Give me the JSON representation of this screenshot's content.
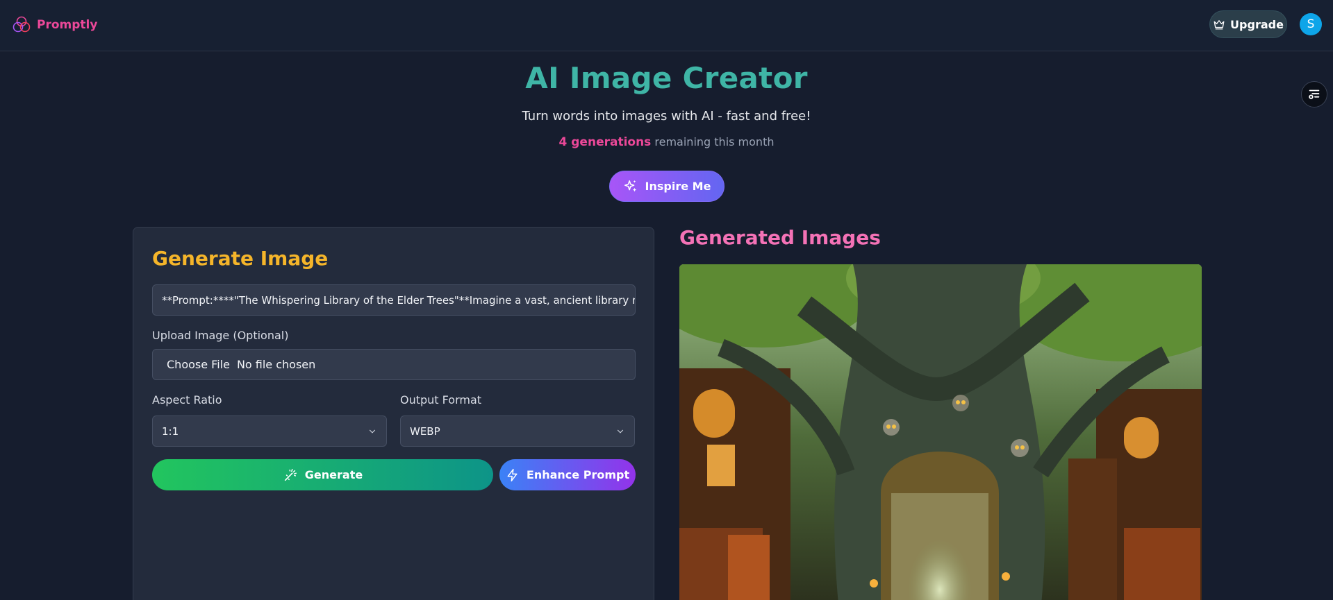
{
  "header": {
    "brand": "Promptly",
    "upgrade_label": "Upgrade",
    "avatar_initial": "S"
  },
  "hero": {
    "title": "AI Image Creator",
    "subtitle": "Turn words into images with AI - fast and free!",
    "generations_count": "4 generations",
    "generations_suffix": " remaining this month",
    "inspire_label": "Inspire Me"
  },
  "form": {
    "title": "Generate Image",
    "prompt_value": "**Prompt:****\"The Whispering Library of the Elder Trees\"**Imagine a vast, ancient library ne",
    "upload_label": "Upload Image (Optional)",
    "file_button": "Choose File",
    "file_status": "No file chosen",
    "aspect_label": "Aspect Ratio",
    "aspect_value": "1:1",
    "format_label": "Output Format",
    "format_value": "WEBP",
    "generate_label": "Generate",
    "enhance_label": "Enhance Prompt"
  },
  "results": {
    "title": "Generated Images"
  },
  "colors": {
    "brand": "#ec4899",
    "hero_title": "#3fb5a6",
    "form_title": "#f5b52a",
    "results_title": "#f472b6"
  },
  "icons": [
    "logo-icon",
    "crown-icon",
    "filter-icon",
    "sparkles-icon",
    "chevron-down-icon",
    "magic-wand-icon",
    "lightning-icon"
  ]
}
